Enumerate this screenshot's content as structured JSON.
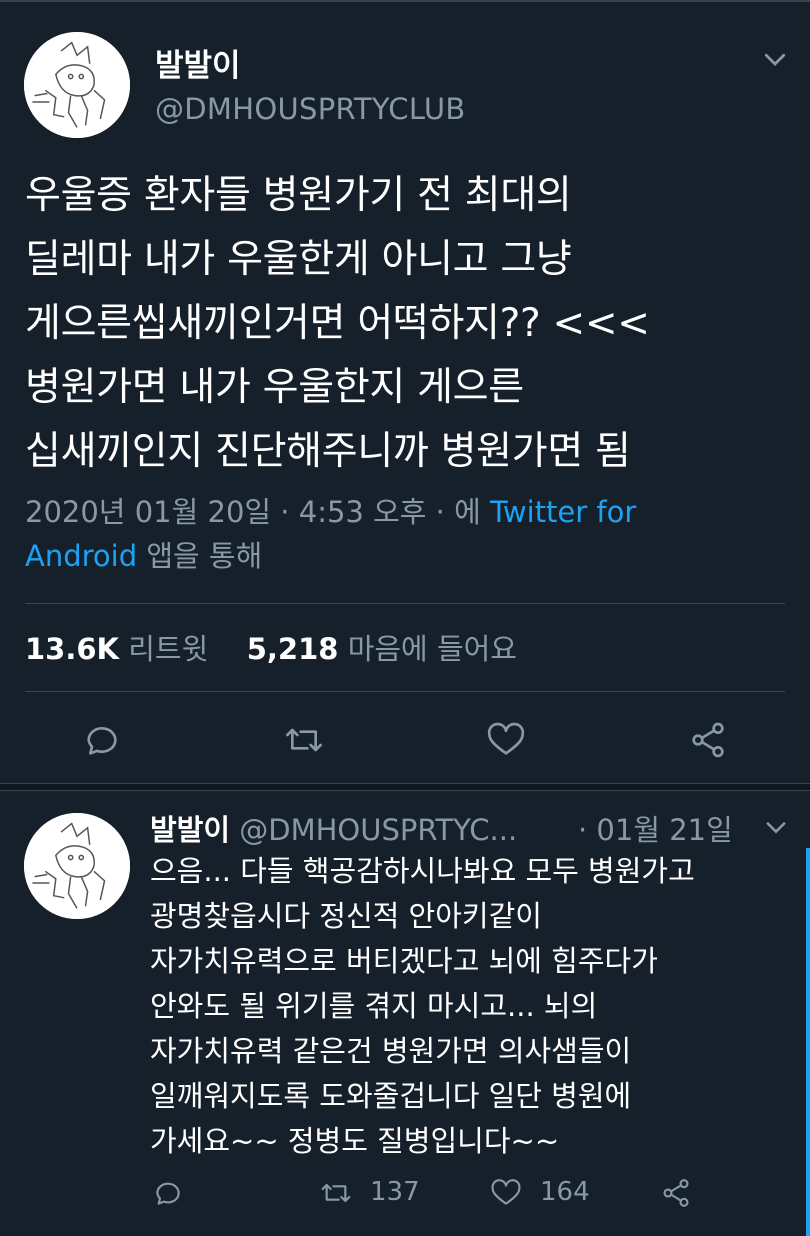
{
  "tweet": {
    "author_name": "발발이",
    "author_handle": "@DMHOUSPRTYCLUB",
    "text": "우울증 환자들 병원가기 전 최대의\n딜레마 내가 우울한게 아니고 그냥\n게으른씹새끼인거면 어떡하지?? <<<\n병원가면 내가 우울한지 게으른\n십새끼인지 진단해주니까 병원가면 됨",
    "timestamp": "2020년 01월 20일 · 4:53 오후 · 에",
    "client_line1": "Twitter for",
    "client_line2": "Android",
    "via_suffix": " 앱을 통해",
    "retweets_count": "13.6K",
    "retweets_label": "리트윗",
    "likes_count": "5,218",
    "likes_label": "마음에 들어요"
  },
  "reply": {
    "author_name": "발발이",
    "author_handle": "@DMHOUSPRTYC...",
    "date": "· 01월 21일",
    "text": "으음... 다들 핵공감하시나봐요 모두 병원가고\n광명찾읍시다 정신적 안아키같이\n자가치유력으로 버티겠다고 뇌에 힘주다가\n안와도 될 위기를 겪지 마시고... 뇌의\n자가치유력 같은건 병원가면 의사샘들이\n일깨워지도록 도와줄겁니다 일단 병원에\n가세요~~ 정병도 질병입니다~~",
    "retweets": "137",
    "likes": "164"
  },
  "icons": {
    "reply": "reply-icon",
    "retweet": "retweet-icon",
    "like": "heart-icon",
    "share": "share-icon",
    "more": "chevron-down-icon"
  },
  "colors": {
    "background": "#15202b",
    "link": "#1da1f2",
    "muted": "#8899a6",
    "divider": "#38444d"
  }
}
